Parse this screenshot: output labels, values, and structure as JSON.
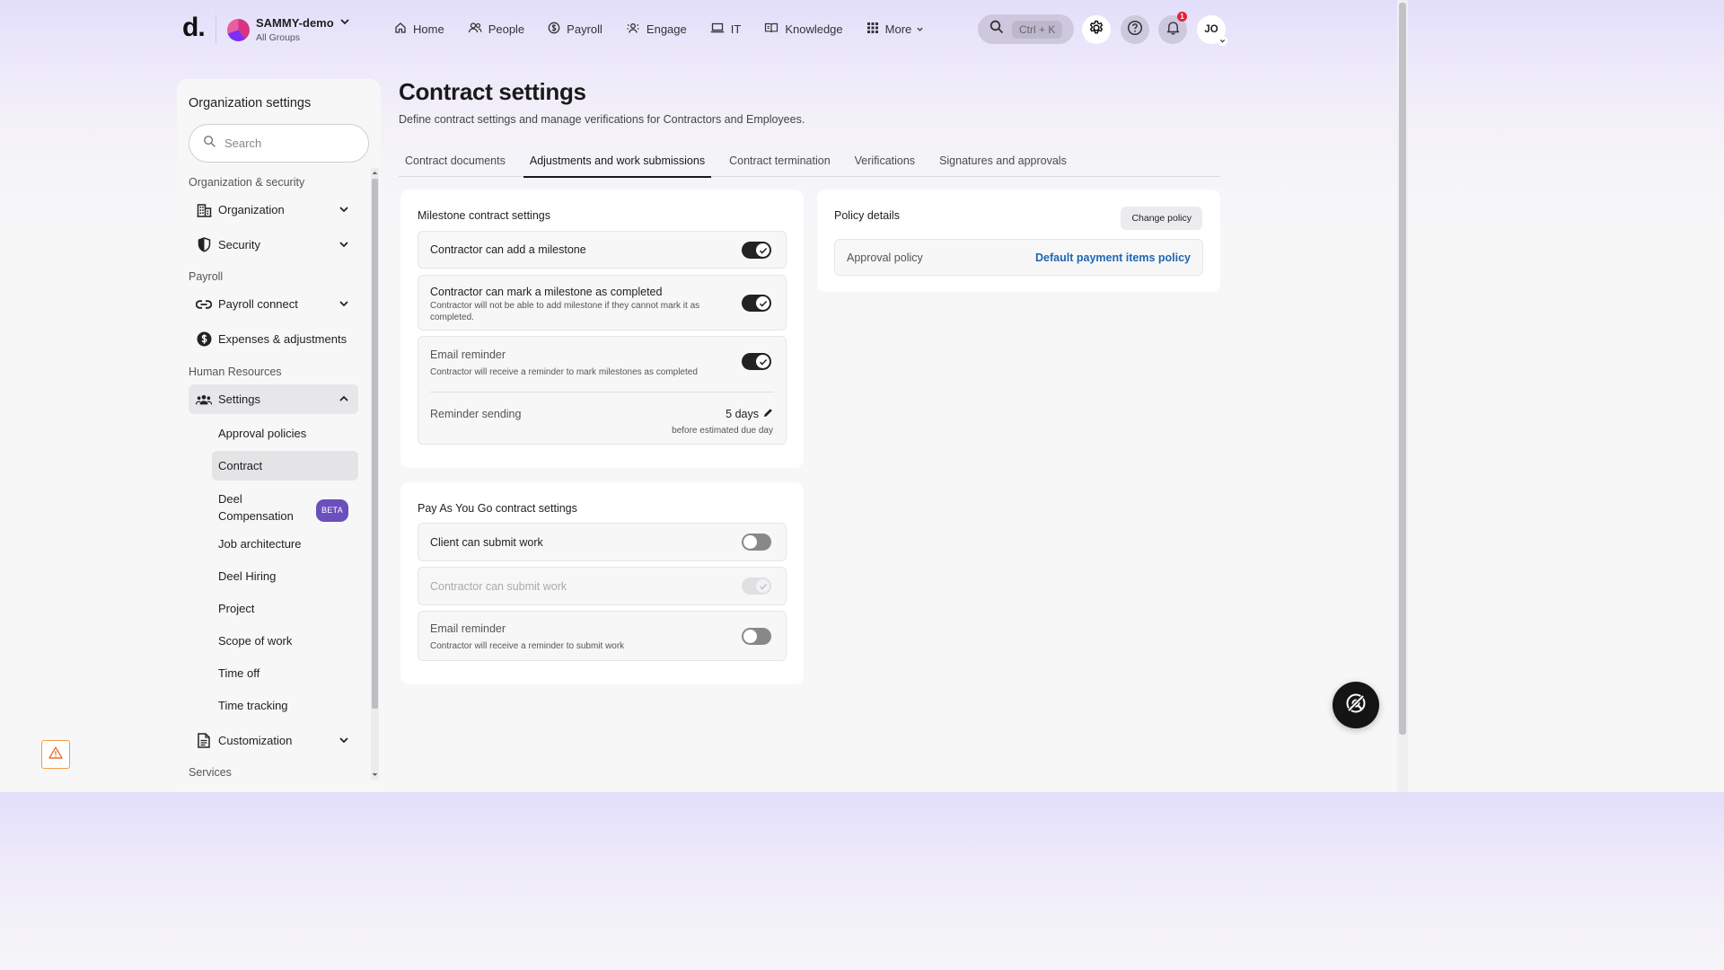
{
  "topbar": {
    "logo": "d.",
    "org_name": "SAMMY-demo",
    "org_sub": "All Groups",
    "nav": [
      {
        "label": "Home",
        "icon": "home-icon"
      },
      {
        "label": "People",
        "icon": "people-icon"
      },
      {
        "label": "Payroll",
        "icon": "payroll-icon"
      },
      {
        "label": "Engage",
        "icon": "engage-icon"
      },
      {
        "label": "IT",
        "icon": "laptop-icon"
      },
      {
        "label": "Knowledge",
        "icon": "book-icon"
      },
      {
        "label": "More",
        "icon": "grid-icon"
      }
    ],
    "search_shortcut": "Ctrl + K",
    "notification_count": "1",
    "avatar_initials": "JO"
  },
  "sidebar": {
    "title": "Organization settings",
    "search_placeholder": "Search",
    "sections": {
      "org_security": "Organization & security",
      "payroll": "Payroll",
      "human_resources": "Human Resources",
      "services": "Services"
    },
    "items": {
      "organization": "Organization",
      "security": "Security",
      "payroll_connect": "Payroll connect",
      "expenses": "Expenses & adjustments",
      "settings": "Settings",
      "customization": "Customization"
    },
    "subitems": [
      {
        "label": "Approval policies"
      },
      {
        "label": "Contract",
        "active": true
      },
      {
        "label": "Deel Compensation",
        "badge": "BETA"
      },
      {
        "label": "Job architecture"
      },
      {
        "label": "Deel Hiring"
      },
      {
        "label": "Project"
      },
      {
        "label": "Scope of work"
      },
      {
        "label": "Time off"
      },
      {
        "label": "Time tracking"
      }
    ]
  },
  "main": {
    "title": "Contract settings",
    "subtitle": "Define contract settings and manage verifications for Contractors and Employees.",
    "tabs": [
      {
        "label": "Contract documents"
      },
      {
        "label": "Adjustments and work submissions",
        "active": true
      },
      {
        "label": "Contract termination"
      },
      {
        "label": "Verifications"
      },
      {
        "label": "Signatures and approvals"
      }
    ],
    "milestone": {
      "title": "Milestone contract settings",
      "add_milestone": {
        "label": "Contractor can add a milestone",
        "enabled": true
      },
      "mark_completed": {
        "label": "Contractor can mark a milestone as completed",
        "desc": "Contractor will not be able to add milestone if they cannot mark it as completed.",
        "enabled": true
      },
      "email_reminder": {
        "label": "Email reminder",
        "desc": "Contractor will receive a reminder to mark milestones as completed",
        "enabled": true
      },
      "reminder_sending": {
        "label": "Reminder sending",
        "value": "5 days",
        "note": "before estimated due day"
      }
    },
    "payg": {
      "title": "Pay As You Go contract settings",
      "client_submit": {
        "label": "Client can submit work",
        "enabled": false
      },
      "contractor_submit": {
        "label": "Contractor can submit work",
        "enabled": true,
        "disabled": true
      },
      "email_reminder": {
        "label": "Email reminder",
        "desc": "Contractor will receive a reminder to submit work",
        "enabled": false
      }
    },
    "policy": {
      "title": "Policy details",
      "change_button": "Change policy",
      "approval_label": "Approval policy",
      "approval_value": "Default payment items policy"
    }
  },
  "colors": {
    "accent_link": "#2066b0",
    "toggle_on": "#222222",
    "beta_badge": "#6b4fbb",
    "notification": "#e5213b"
  }
}
